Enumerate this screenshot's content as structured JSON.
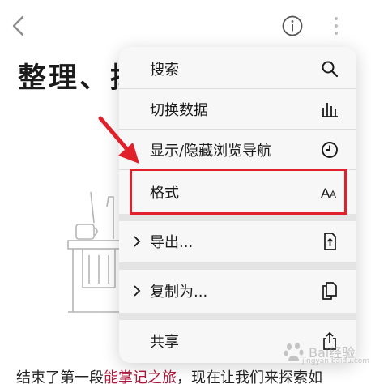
{
  "header": {
    "back_icon": "chevron-left-icon",
    "info_icon": "info-circle-icon",
    "more_icon": "vertical-dots-icon"
  },
  "page": {
    "title": "整理、掉",
    "body_prefix": "结束了第一段",
    "body_link": "能掌记之旅",
    "body_suffix": "，现在让我们来探索如"
  },
  "menu": {
    "items": [
      {
        "label": "搜索",
        "icon": "search-icon",
        "has_submenu": false
      },
      {
        "label": "切换数据",
        "icon": "bar-chart-icon",
        "has_submenu": false
      },
      {
        "label": "显示/隐藏浏览导航",
        "icon": "clock-icon",
        "has_submenu": false
      },
      {
        "label": "格式",
        "icon": "font-size-icon",
        "has_submenu": false
      },
      {
        "label": "导出...",
        "icon": "export-file-icon",
        "has_submenu": true
      },
      {
        "label": "复制为...",
        "icon": "copy-as-icon",
        "has_submenu": true
      },
      {
        "label": "共享",
        "icon": "share-icon",
        "has_submenu": false
      }
    ]
  },
  "annotation": {
    "highlight_color": "#e0202a",
    "highlighted_item": "格式"
  },
  "watermark": {
    "text": "Bai经验",
    "url": "jingyan.baidu.com"
  }
}
